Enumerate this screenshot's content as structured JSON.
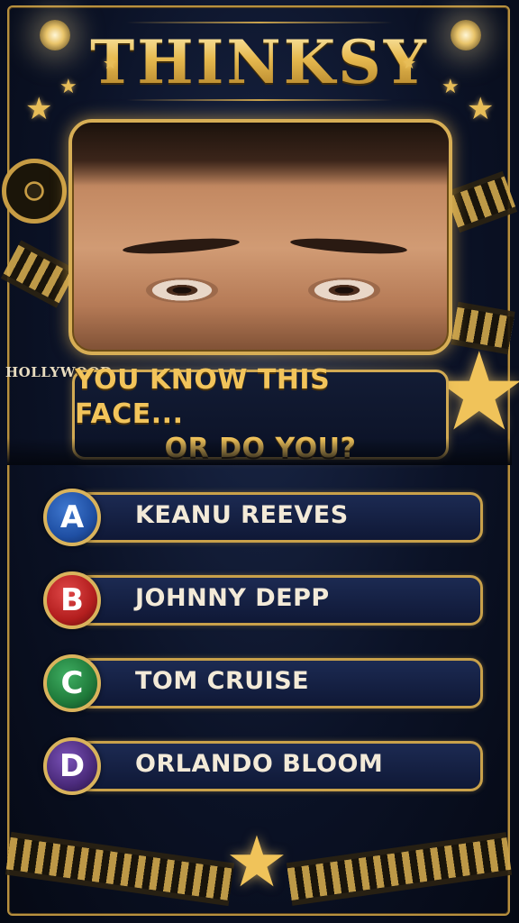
{
  "app": {
    "title": "THINKSY"
  },
  "photo": {
    "alt": "close-up of eyes"
  },
  "decor": {
    "sign": "HOLLYWOOD"
  },
  "question": {
    "line1": "YOU KNOW THIS FACE...",
    "line2": "OR DO YOU?"
  },
  "answers": [
    {
      "letter": "A",
      "label": "KEANU REEVES",
      "color": "#1f4fa3"
    },
    {
      "letter": "B",
      "label": "JOHNNY DEPP",
      "color": "#b31e1e"
    },
    {
      "letter": "C",
      "label": "TOM CRUISE",
      "color": "#1f7a3a"
    },
    {
      "letter": "D",
      "label": "ORLANDO BLOOM",
      "color": "#4a2a7a"
    }
  ],
  "colors": {
    "gold": "#d2aa53",
    "navy": "#0b1226"
  }
}
